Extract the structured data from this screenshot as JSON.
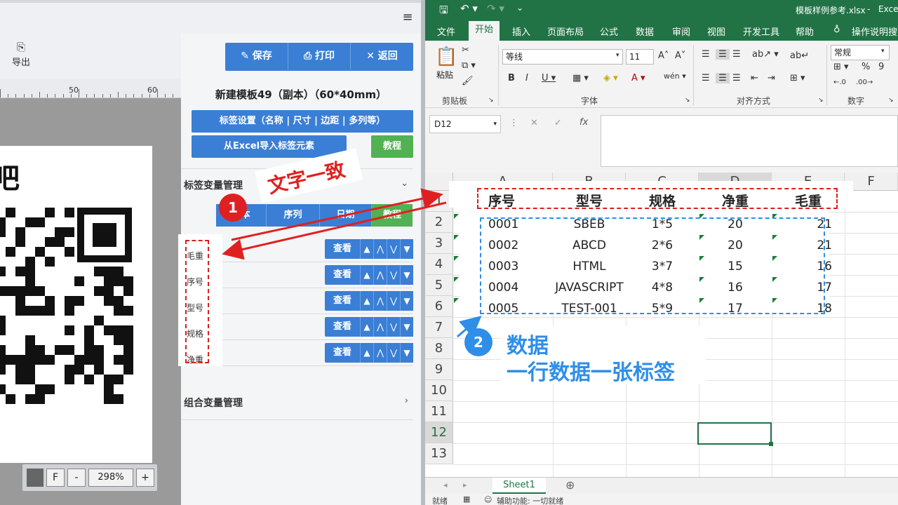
{
  "left_app": {
    "export_label": "导出",
    "toolbar": {
      "save": "保存",
      "print": "打印",
      "back": "返回"
    },
    "ruler": {
      "marks": [
        "50",
        "60"
      ]
    },
    "template_title": "新建模板49（副本）（60*40mm）",
    "label_settings_button": "标签设置（名称 | 尺寸 | 边距 | 多列等）",
    "import_excel_button": "从Excel导入标签元素",
    "tutorial_button": "教程",
    "canvas_glyph": "吧",
    "var_section": {
      "title": "标签变量管理",
      "tabs": [
        "文本",
        "序列",
        "日期",
        "教程"
      ],
      "view_label": "查看",
      "items": [
        "毛重",
        "序号",
        "型号",
        "规格",
        "净重"
      ]
    },
    "combo_section": {
      "title": "组合变量管理"
    },
    "zoom": {
      "fit_label": "F",
      "minus": "-",
      "value": "298%",
      "plus": "+"
    }
  },
  "excel": {
    "file_title": "模板样例参考.xlsx",
    "app_name": "Excel",
    "tabs": [
      "文件",
      "开始",
      "插入",
      "页面布局",
      "公式",
      "数据",
      "审阅",
      "视图",
      "开发工具",
      "帮助",
      "操作说明搜索"
    ],
    "ribbon": {
      "paste_label": "粘贴",
      "clipboard_group": "剪贴板",
      "font_name": "等线",
      "font_size": "11",
      "font_group": "字体",
      "align_group": "对齐方式",
      "number_format": "常规",
      "number_group": "数字"
    },
    "name_box": "D12",
    "columns": [
      "A",
      "B",
      "C",
      "D",
      "E",
      "F"
    ],
    "rows": [
      "1",
      "2",
      "3",
      "4",
      "5",
      "6",
      "7",
      "8",
      "9",
      "10",
      "11",
      "12",
      "13"
    ],
    "headers": [
      "序号",
      "型号",
      "规格",
      "净重",
      "毛重"
    ],
    "data_rows": [
      [
        "0001",
        "SBEB",
        "1*5",
        "20",
        "21"
      ],
      [
        "0002",
        "ABCD",
        "2*6",
        "20",
        "21"
      ],
      [
        "0003",
        "HTML",
        "3*7",
        "15",
        "16"
      ],
      [
        "0004",
        "JAVASCRIPT",
        "4*8",
        "16",
        "17"
      ],
      [
        "0005",
        "TEST-001",
        "5*9",
        "17",
        "18"
      ]
    ],
    "sheet_tab": "Sheet1",
    "status": {
      "ready": "就绪",
      "accessibility": "辅助功能: 一切就绪"
    }
  },
  "annotations": {
    "step1": {
      "number": "1",
      "text": "文字一致",
      "color": "#e02020"
    },
    "step2": {
      "number": "2",
      "line1": "数据",
      "line2": "一行数据一张标签",
      "color": "#2f8ee8"
    }
  },
  "colors": {
    "excel_green": "#217346",
    "button_blue": "#3a7fd5",
    "button_green": "#52b152"
  }
}
